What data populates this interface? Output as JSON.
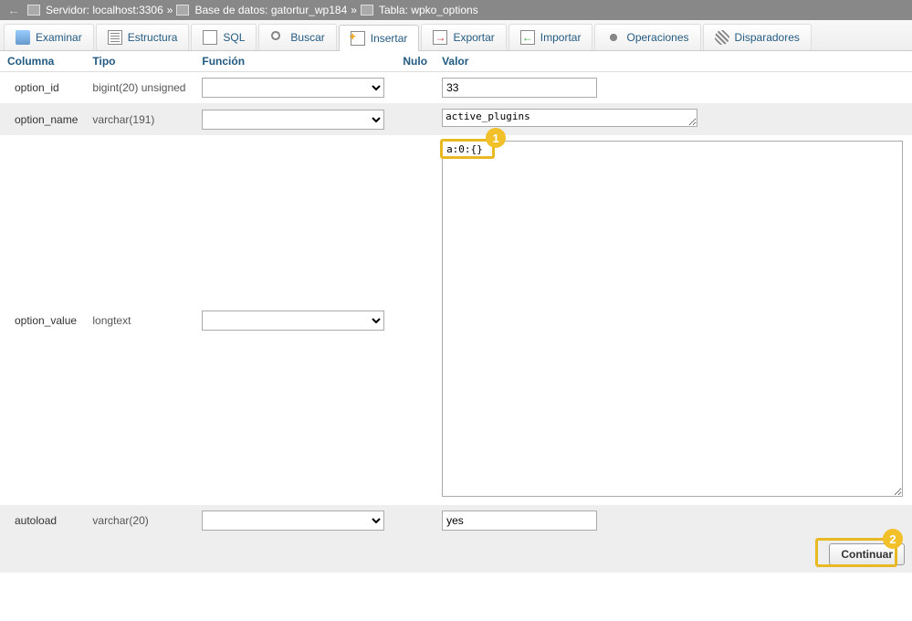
{
  "breadcrumb": {
    "server_label": "Servidor:",
    "server": "localhost:3306",
    "db_label": "Base de datos:",
    "db": "gatortur_wp184",
    "table_label": "Tabla:",
    "table": "wpko_options",
    "sep": "»"
  },
  "tabs": [
    {
      "label": "Examinar",
      "icon": "browse"
    },
    {
      "label": "Estructura",
      "icon": "struct"
    },
    {
      "label": "SQL",
      "icon": "sql"
    },
    {
      "label": "Buscar",
      "icon": "search"
    },
    {
      "label": "Insertar",
      "icon": "insert",
      "active": true
    },
    {
      "label": "Exportar",
      "icon": "export"
    },
    {
      "label": "Importar",
      "icon": "import"
    },
    {
      "label": "Operaciones",
      "icon": "ops"
    },
    {
      "label": "Disparadores",
      "icon": "trig"
    }
  ],
  "headers": {
    "column": "Columna",
    "type": "Tipo",
    "function": "Función",
    "null": "Nulo",
    "value": "Valor"
  },
  "rows": [
    {
      "name": "option_id",
      "type": "bigint(20) unsigned",
      "value": "33",
      "ctrl": "text"
    },
    {
      "name": "option_name",
      "type": "varchar(191)",
      "value": "active_plugins",
      "ctrl": "textarea-sm"
    },
    {
      "name": "option_value",
      "type": "longtext",
      "value": "a:0:{}",
      "ctrl": "textarea-lg"
    },
    {
      "name": "autoload",
      "type": "varchar(20)",
      "value": "yes",
      "ctrl": "text"
    }
  ],
  "submit": {
    "label": "Continuar"
  },
  "annotations": {
    "badge1": "1",
    "badge2": "2"
  }
}
